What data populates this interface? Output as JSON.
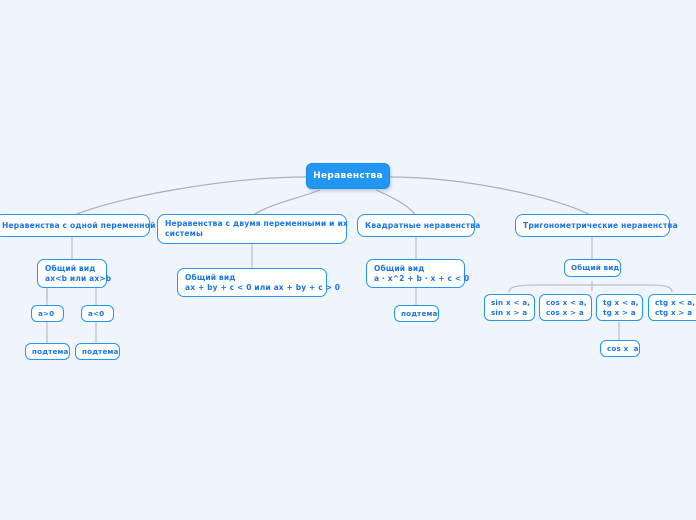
{
  "meta": {
    "root_label": "Неравенства",
    "background_color": "#f0f4fd",
    "node_accent_color": "#2196f3",
    "node_text_color": "#1976e8",
    "edge_color": "#9aa3ad"
  },
  "nodes": {
    "root": {
      "label": "Неравенства"
    },
    "branch_one_var": {
      "label": "Неравенства с одной переменной"
    },
    "branch_two_var": {
      "label": "Неравенства с двумя переменными и их\nсистемы"
    },
    "branch_quadratic": {
      "label": "Квадратные неравенства"
    },
    "branch_trig": {
      "label": "Тригонометрические неравенства"
    },
    "general_one_var": {
      "label": "Общий вид\nax<b или ax>b"
    },
    "general_two_var": {
      "label": "Общий вид\nax + by + c < 0 или ax + by + c > 0"
    },
    "general_quadratic": {
      "label": "Общий вид\na · x^2 + b · x + c < 0"
    },
    "general_trig": {
      "label": "Общий вид"
    },
    "a_gt_0": {
      "label": "a>0"
    },
    "a_lt_0": {
      "label": "a<0"
    },
    "subtopic_a_gt_0": {
      "label": "подтема"
    },
    "subtopic_a_lt_0": {
      "label": "подтема"
    },
    "subtopic_quadratic": {
      "label": "подтема"
    },
    "trig_sin": {
      "label": "sin x < a,\nsin x > a"
    },
    "trig_cos": {
      "label": "cos x < a,\ncos x > a"
    },
    "trig_tg": {
      "label": "tg x < a,\ntg x > a"
    },
    "trig_ctg": {
      "label": "ctg x < a,\nctg x > a"
    },
    "trig_cos_child": {
      "label": "cos x  a"
    }
  }
}
